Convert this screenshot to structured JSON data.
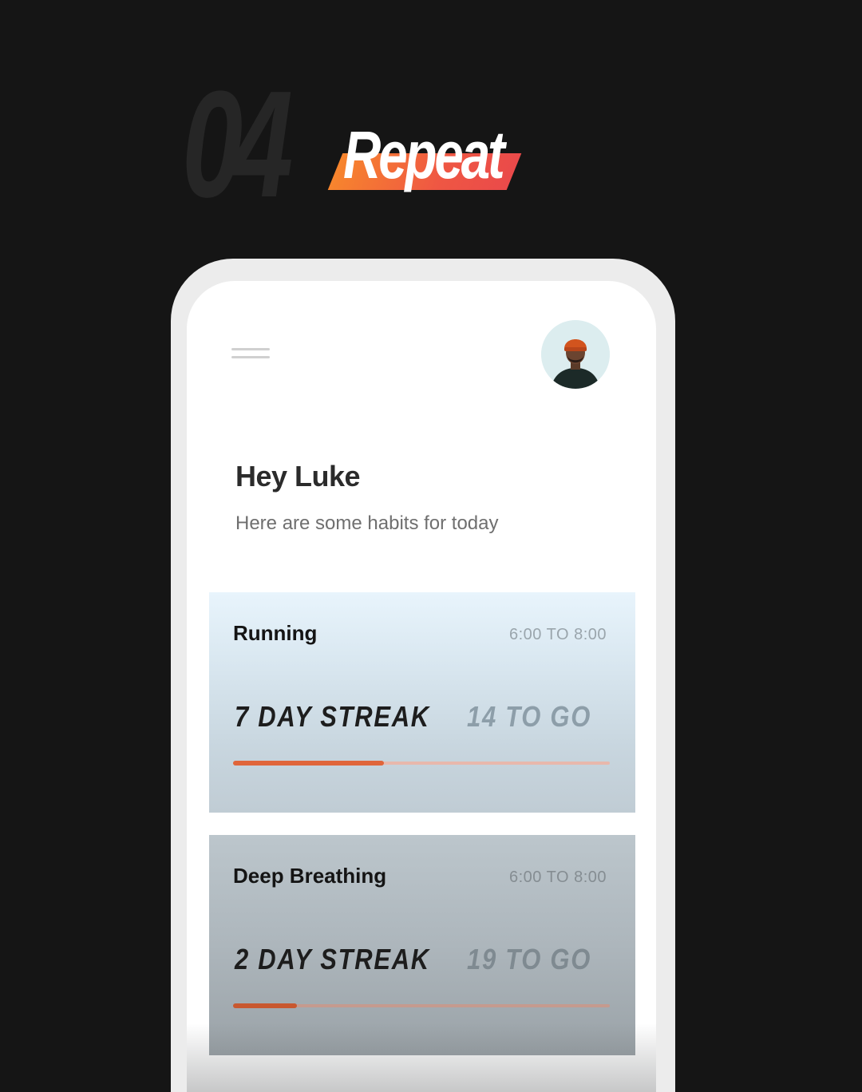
{
  "header": {
    "step_number": "04",
    "step_title": "Repeat"
  },
  "app": {
    "greeting": "Hey Luke",
    "subtitle": "Here are some habits for today",
    "menu_icon": "hamburger-menu-icon",
    "avatar": "user-avatar"
  },
  "habits": [
    {
      "name": "Running",
      "time": "6:00 TO 8:00",
      "streak": "7 DAY STREAK",
      "to_go": "14 TO GO",
      "progress": 0.4
    },
    {
      "name": "Deep Breathing",
      "time": "6:00 TO 8:00",
      "streak": "2 DAY STREAK",
      "to_go": "19 TO GO",
      "progress": 0.17
    }
  ],
  "colors": {
    "background": "#151515",
    "accent_start": "#f7852d",
    "accent_end": "#ea4a4a",
    "progress_fill": "#e0653a",
    "progress_track": "#e8b8ac"
  }
}
